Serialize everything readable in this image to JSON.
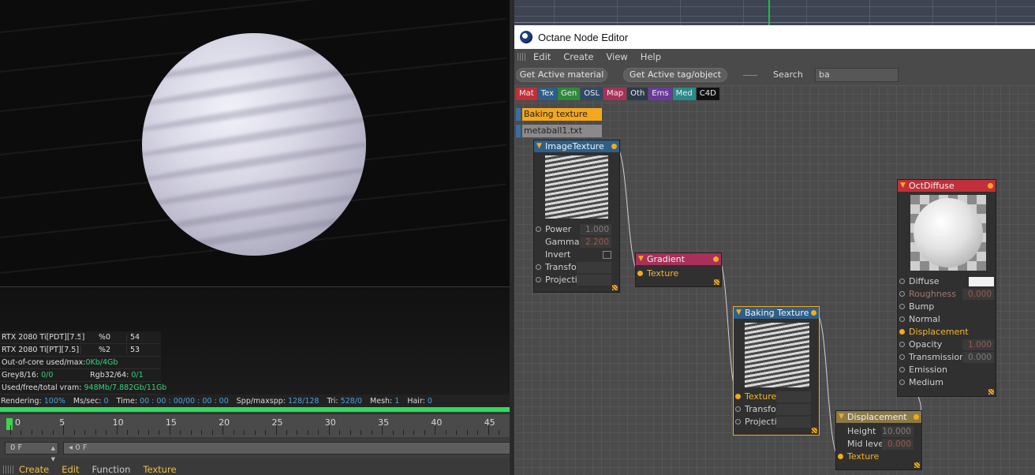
{
  "viewport": {
    "gpu_rows": [
      {
        "name": "RTX 2080 Ti[PDT][7.5]",
        "pct": "%0",
        "temp": "54"
      },
      {
        "name": "RTX 2080 Ti[PT][7.5]",
        "pct": "%2",
        "temp": "53"
      }
    ],
    "out_of_core_label": "Out-of-core used/max:",
    "out_of_core_value": "0Kb/4Gb",
    "grey_label": "Grey8/16:",
    "grey_value": "0/0",
    "rgb_label": "Rgb32/64:",
    "rgb_value": "0/1",
    "vram_label": "Used/free/total vram:",
    "vram_value": "948Mb/7.882Gb/11Gb",
    "render": {
      "rendering_label": "Rendering:",
      "rendering_value": "100%",
      "mssec_label": "Ms/sec:",
      "mssec_value": "0",
      "time_label": "Time:",
      "time_value": "00 : 00 : 00/00 : 00 : 00",
      "spp_label": "Spp/maxspp:",
      "spp_value": "128/128",
      "tri_label": "Tri:",
      "tri_value": "528/0",
      "mesh_label": "Mesh:",
      "mesh_value": "1",
      "hair_label": "Hair:",
      "hair_value": "0"
    },
    "progress_fraction": 1.0
  },
  "timeline": {
    "labels": [
      "0",
      "5",
      "10",
      "15",
      "20",
      "25",
      "30",
      "35",
      "40",
      "45"
    ],
    "current_frame": "0 F",
    "slider_text": "0 F"
  },
  "bottom_menu": {
    "create": "Create",
    "edit": "Edit",
    "function": "Function",
    "texture": "Texture"
  },
  "node_editor": {
    "title": "Octane Node Editor",
    "menu": {
      "edit": "Edit",
      "create": "Create",
      "view": "View",
      "help": "Help"
    },
    "toolbar": {
      "get_active_material": "Get Active material",
      "get_active_tag": "Get Active tag/object",
      "search_label": "Search",
      "search_value": "ba"
    },
    "categories": [
      {
        "label": "Mat",
        "color": "#c0303a"
      },
      {
        "label": "Tex",
        "color": "#2e5f88"
      },
      {
        "label": "Gen",
        "color": "#2e8a3a"
      },
      {
        "label": "OSL",
        "color": "#2f4a66"
      },
      {
        "label": "Map",
        "color": "#a8305a"
      },
      {
        "label": "Oth",
        "color": "#2e3a48"
      },
      {
        "label": "Ems",
        "color": "#6a3a9a"
      },
      {
        "label": "Med",
        "color": "#2a8a88"
      },
      {
        "label": "C4D",
        "color": "#111111"
      }
    ],
    "tags": {
      "baking": "Baking texture",
      "metaball": "metaball1.txt"
    },
    "nodes": {
      "image_texture": {
        "title": "ImageTexture",
        "power_label": "Power",
        "power_value": "1.000",
        "gamma_label": "Gamma",
        "gamma_value": "2.200",
        "invert_label": "Invert",
        "transform_label": "Transform",
        "projection_label": "Projection"
      },
      "gradient": {
        "title": "Gradient",
        "texture_label": "Texture"
      },
      "baking_texture": {
        "title": "Baking Texture",
        "texture_label": "Texture",
        "transform_label": "Transform",
        "projection_label": "Projection"
      },
      "displacement": {
        "title": "Displacement",
        "height_label": "Height",
        "height_value": "10.000",
        "midlevel_label": "Mid level",
        "midlevel_value": "0.000",
        "texture_label": "Texture"
      },
      "oct_diffuse": {
        "title": "OctDiffuse",
        "diffuse_label": "Diffuse",
        "roughness_label": "Roughness",
        "roughness_value": "0.000",
        "bump_label": "Bump",
        "normal_label": "Normal",
        "displacement_label": "Displacement",
        "opacity_label": "Opacity",
        "opacity_value": "1.000",
        "transmission_label": "Transmission",
        "transmission_value": "0.000",
        "emission_label": "Emission",
        "medium_label": "Medium"
      }
    },
    "colors": {
      "accent_orange": "#f5a81d",
      "image_texture_header": "#2e5f88",
      "gradient_header": "#a8305a",
      "baking_header": "#2e5f88",
      "displacement_header": "#8a7a4a",
      "diffuse_header": "#c0303a"
    }
  }
}
